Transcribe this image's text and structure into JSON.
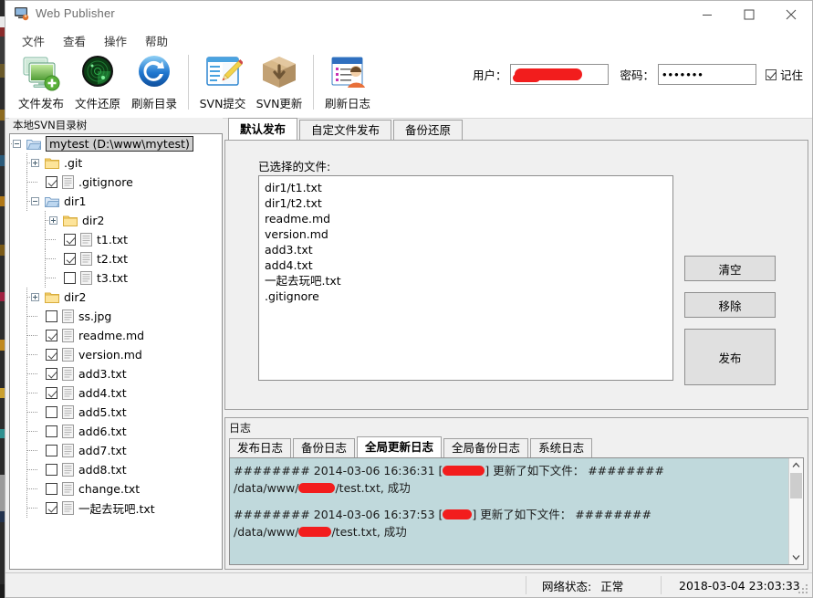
{
  "window": {
    "title": "Web Publisher",
    "icon": "monitor-icon",
    "controls": {
      "minimize": "minimize-icon",
      "maximize": "maximize-icon",
      "close": "close-icon"
    }
  },
  "menu": {
    "items": [
      {
        "label": "文件",
        "name": "menu-file"
      },
      {
        "label": "查看",
        "name": "menu-view"
      },
      {
        "label": "操作",
        "name": "menu-operation"
      },
      {
        "label": "帮助",
        "name": "menu-help"
      }
    ]
  },
  "toolbar": {
    "buttons": [
      {
        "label": "文件发布",
        "icon": "publish-file-icon"
      },
      {
        "label": "文件还原",
        "icon": "restore-file-icon"
      },
      {
        "label": "刷新目录",
        "icon": "refresh-directory-icon"
      },
      {
        "label": "SVN提交",
        "icon": "svn-commit-icon"
      },
      {
        "label": "SVN更新",
        "icon": "svn-update-icon"
      },
      {
        "label": "刷新日志",
        "icon": "refresh-log-icon"
      }
    ]
  },
  "login": {
    "user_label": "用户：",
    "user_value": "",
    "password_label": "密码：",
    "password_value": "•••••••",
    "remember_label": "记住",
    "remember_checked": true
  },
  "tree": {
    "header": "本地SVN目录树",
    "nodes": [
      {
        "label": "mytest (D:\\www\\mytest)",
        "depth": 0,
        "kind": "folder-open",
        "expander": "minus",
        "checkbox": "none",
        "selected": true
      },
      {
        "label": ".git",
        "depth": 1,
        "kind": "folder",
        "expander": "plus",
        "checkbox": "none",
        "selected": false
      },
      {
        "label": ".gitignore",
        "depth": 1,
        "kind": "file",
        "expander": "none",
        "checkbox": "checked",
        "selected": false
      },
      {
        "label": "dir1",
        "depth": 1,
        "kind": "folder-open",
        "expander": "minus",
        "checkbox": "none",
        "selected": false
      },
      {
        "label": "dir2",
        "depth": 2,
        "kind": "folder",
        "expander": "plus",
        "checkbox": "none",
        "selected": false
      },
      {
        "label": "t1.txt",
        "depth": 2,
        "kind": "file",
        "expander": "none",
        "checkbox": "checked",
        "selected": false
      },
      {
        "label": "t2.txt",
        "depth": 2,
        "kind": "file",
        "expander": "none",
        "checkbox": "checked",
        "selected": false
      },
      {
        "label": "t3.txt",
        "depth": 2,
        "kind": "file",
        "expander": "none",
        "checkbox": "unchecked",
        "selected": false
      },
      {
        "label": "dir2",
        "depth": 1,
        "kind": "folder",
        "expander": "plus",
        "checkbox": "none",
        "selected": false
      },
      {
        "label": "ss.jpg",
        "depth": 1,
        "kind": "file",
        "expander": "none",
        "checkbox": "unchecked",
        "selected": false
      },
      {
        "label": "readme.md",
        "depth": 1,
        "kind": "file",
        "expander": "none",
        "checkbox": "checked",
        "selected": false
      },
      {
        "label": "version.md",
        "depth": 1,
        "kind": "file",
        "expander": "none",
        "checkbox": "checked",
        "selected": false
      },
      {
        "label": "add3.txt",
        "depth": 1,
        "kind": "file",
        "expander": "none",
        "checkbox": "checked",
        "selected": false
      },
      {
        "label": "add4.txt",
        "depth": 1,
        "kind": "file",
        "expander": "none",
        "checkbox": "checked",
        "selected": false
      },
      {
        "label": "add5.txt",
        "depth": 1,
        "kind": "file",
        "expander": "none",
        "checkbox": "unchecked",
        "selected": false
      },
      {
        "label": "add6.txt",
        "depth": 1,
        "kind": "file",
        "expander": "none",
        "checkbox": "unchecked",
        "selected": false
      },
      {
        "label": "add7.txt",
        "depth": 1,
        "kind": "file",
        "expander": "none",
        "checkbox": "unchecked",
        "selected": false
      },
      {
        "label": "add8.txt",
        "depth": 1,
        "kind": "file",
        "expander": "none",
        "checkbox": "unchecked",
        "selected": false
      },
      {
        "label": "change.txt",
        "depth": 1,
        "kind": "file",
        "expander": "none",
        "checkbox": "unchecked",
        "selected": false
      },
      {
        "label": "一起去玩吧.txt",
        "depth": 1,
        "kind": "file",
        "expander": "none",
        "checkbox": "checked",
        "selected": false
      }
    ]
  },
  "main_tabs": [
    {
      "label": "默认发布",
      "active": true
    },
    {
      "label": "自定文件发布",
      "active": false
    },
    {
      "label": "备份还原",
      "active": false
    }
  ],
  "publish_panel": {
    "selected_label": "已选择的文件:",
    "files": [
      "dir1/t1.txt",
      "dir1/t2.txt",
      "readme.md",
      "version.md",
      "add3.txt",
      "add4.txt",
      "一起去玩吧.txt",
      ".gitignore"
    ],
    "buttons": {
      "clear": "清空",
      "remove": "移除",
      "publish": "发布"
    }
  },
  "log_group": {
    "title": "日志",
    "tabs": [
      {
        "label": "发布日志",
        "active": false
      },
      {
        "label": "备份日志",
        "active": false
      },
      {
        "label": "全局更新日志",
        "active": true
      },
      {
        "label": "全局备份日志",
        "active": false
      },
      {
        "label": "系统日志",
        "active": false
      }
    ],
    "entries": [
      {
        "prefix": "######## 2014-03-06 16:36:31 [",
        "redacted_user_width": 46,
        "middle": "] 更新了如下文件： ########",
        "path_prefix": "/data/www/",
        "redacted_path_width": 40,
        "path_suffix": "/test.txt, 成功"
      },
      {
        "prefix": "######## 2014-03-06 16:37:53 [",
        "redacted_user_width": 32,
        "middle": "] 更新了如下文件： ########",
        "path_prefix": "/data/www/",
        "redacted_path_width": 36,
        "path_suffix": "/test.txt, 成功"
      }
    ]
  },
  "status_bar": {
    "network_label": "网络状态:",
    "network_value": "正常",
    "datetime": "2018-03-04 23:03:33"
  },
  "colors": {
    "panel_bg": "#f0f0f0",
    "log_bg": "#c0d9dc",
    "redaction": "#f21d1d",
    "border": "#8e8e8e",
    "title_text": "#6c6c6c"
  }
}
